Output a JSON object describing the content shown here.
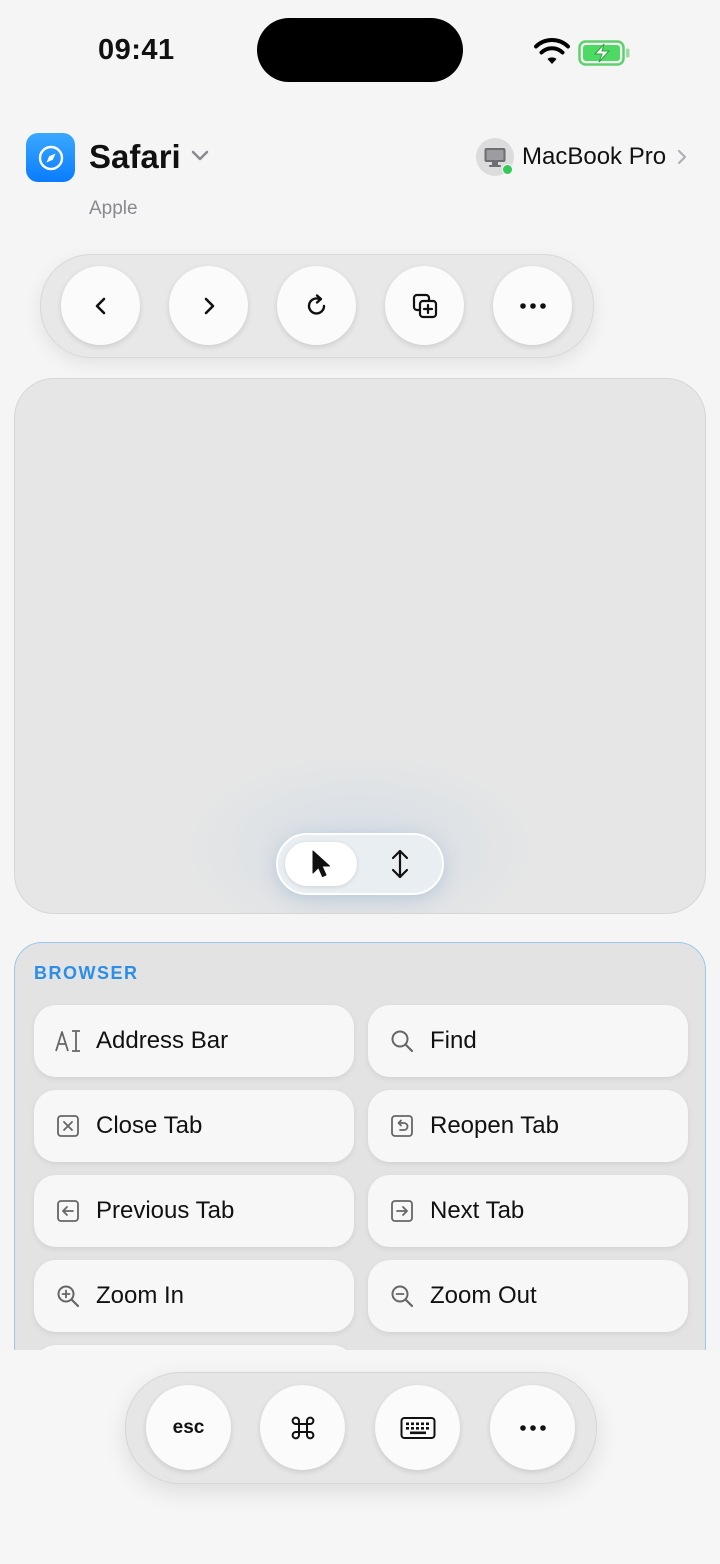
{
  "status_bar": {
    "time": "09:41"
  },
  "header": {
    "app_name": "Safari",
    "app_subtitle": "Apple",
    "app_icon": "compass-icon",
    "device_name": "MacBook Pro",
    "device_status_color": "#34c759"
  },
  "toolbar": {
    "buttons": [
      {
        "icon": "chevron-left-icon"
      },
      {
        "icon": "chevron-right-icon"
      },
      {
        "icon": "reload-icon"
      },
      {
        "icon": "new-tab-icon"
      },
      {
        "icon": "more-icon"
      }
    ]
  },
  "trackpad": {
    "modes": [
      {
        "icon": "pointer-icon",
        "selected": true
      },
      {
        "icon": "scroll-vertical-icon",
        "selected": false
      }
    ]
  },
  "shortcuts": {
    "section_title": "BROWSER",
    "accent_color": "#2d8ee6",
    "items": [
      {
        "label": "Address Bar",
        "icon": "text-cursor-icon"
      },
      {
        "label": "Find",
        "icon": "search-icon"
      },
      {
        "label": "Close Tab",
        "icon": "close-square-icon"
      },
      {
        "label": "Reopen Tab",
        "icon": "reopen-square-icon"
      },
      {
        "label": "Previous Tab",
        "icon": "arrow-left-square-icon"
      },
      {
        "label": "Next Tab",
        "icon": "arrow-right-square-icon"
      },
      {
        "label": "Zoom In",
        "icon": "zoom-in-icon"
      },
      {
        "label": "Zoom Out",
        "icon": "zoom-out-icon"
      }
    ]
  },
  "bottom_bar": {
    "esc_label": "esc",
    "buttons": [
      {
        "icon": "command-icon"
      },
      {
        "icon": "keyboard-icon"
      },
      {
        "icon": "more-icon"
      }
    ]
  }
}
